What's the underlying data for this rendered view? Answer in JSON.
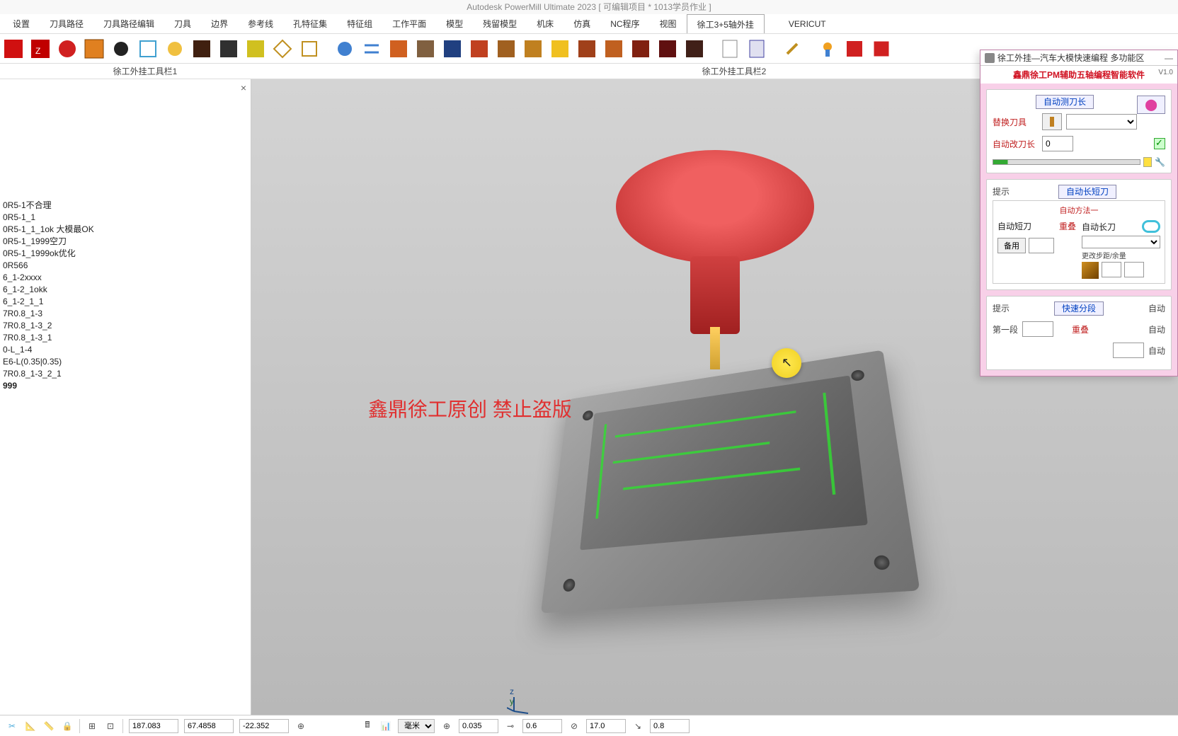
{
  "titlebar": "Autodesk PowerMill Ultimate 2023     [ 可编辑项目 * 1013学员作业 ]",
  "menu": {
    "items": [
      "设置",
      "刀具路径",
      "刀具路径编辑",
      "刀具",
      "边界",
      "参考线",
      "孔特征集",
      "特征组",
      "工作平面",
      "模型",
      "残留模型",
      "机床",
      "仿真",
      "NC程序",
      "视图",
      "徐工3+5轴外挂",
      "VERICUT"
    ],
    "active_index": 15
  },
  "toolbar_labels": {
    "left": "徐工外挂工具栏1",
    "right": "徐工外挂工具栏2"
  },
  "left_panel": {
    "close": "×",
    "tree": [
      "0R5-1不合理",
      "0R5-1_1",
      "0R5-1_1_1ok  大模最OK",
      "0R5-1_1999空刀",
      "0R5-1_1999ok优化",
      "0R566",
      "6_1-2xxxx",
      "6_1-2_1okk",
      "6_1-2_1_1",
      "7R0.8_1-3",
      "7R0.8_1-3_2",
      "7R0.8_1-3_1",
      "0-L_1-4",
      "E6-L(0.35|0.35)",
      "7R0.8_1-3_2_1",
      "999"
    ]
  },
  "watermark": "鑫鼎徐工原创 禁止盗版",
  "axis": {
    "z": "z",
    "y": "y"
  },
  "plugin": {
    "title": "徐工外挂—汽车大模快速编程 多功能区",
    "header": "鑫鼎徐工PM辅助五轴编程智能软件",
    "version": "V1.0",
    "sec1": {
      "head": "自动测刀长",
      "replace_tool": "替换刀具",
      "change_len": "自动改刀长",
      "change_len_val": "0"
    },
    "sec2": {
      "hint": "提示",
      "head": "自动长短刀",
      "method": "自动方法一",
      "short": "自动短刀",
      "long": "自动长刀",
      "overlap": "重叠",
      "spare": "备用",
      "step": "更改步距/余量"
    },
    "sec3": {
      "hint": "提示",
      "head": "快速分段",
      "auto": "自动",
      "first": "第一段",
      "overlap": "重叠"
    }
  },
  "status": {
    "x": "187.083",
    "y": "67.4858",
    "z": "-22.352",
    "unit": "毫米",
    "tol": "0.035",
    "cusp": "0.6",
    "stock": "17.0",
    "stepdown": "0.8"
  }
}
